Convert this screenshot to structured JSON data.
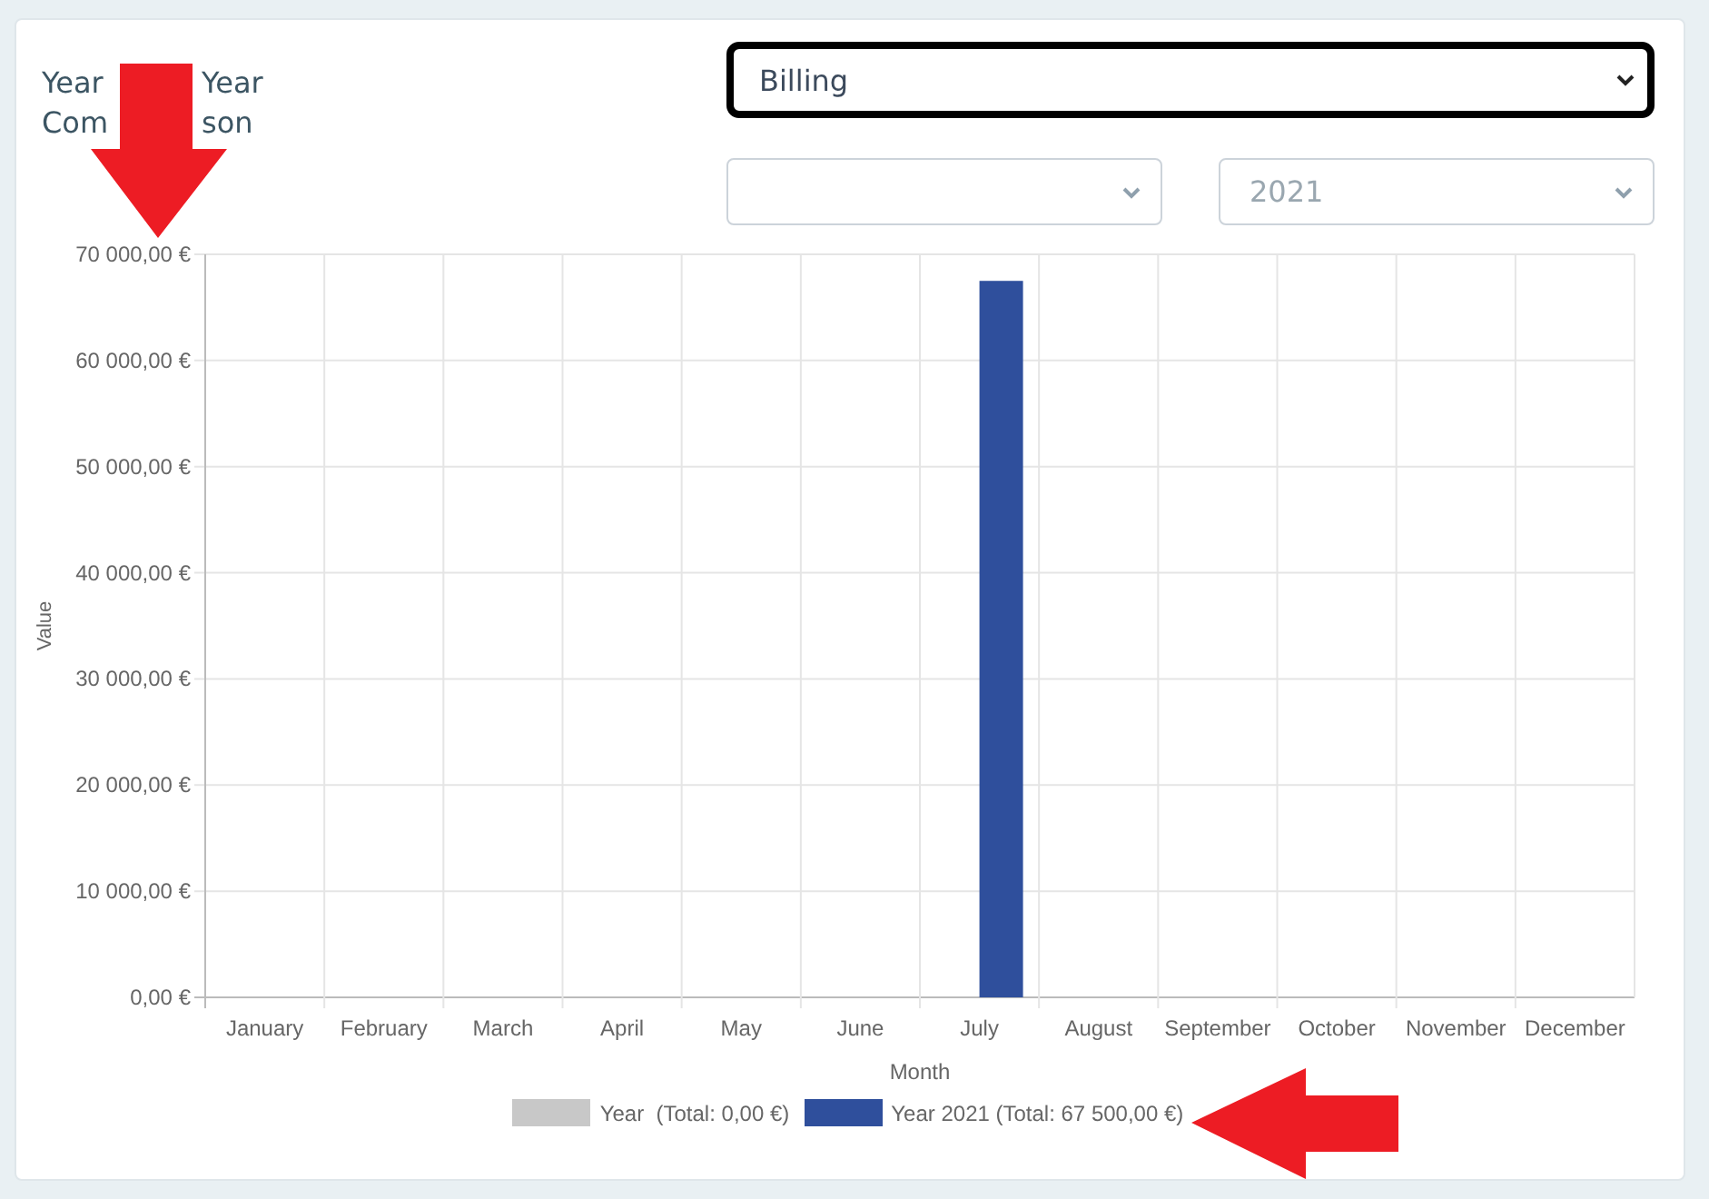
{
  "card": {
    "title_lines": [
      [
        "Year",
        "Year"
      ],
      [
        "Com",
        "son"
      ]
    ]
  },
  "filters": {
    "metric": {
      "value": "Billing",
      "focused": true
    },
    "year": {
      "value": "2021"
    }
  },
  "chart": {
    "chart_data": {
      "type": "bar",
      "grid": true,
      "xlabel": "Month",
      "ylabel": "Value",
      "categories": [
        "January",
        "February",
        "March",
        "April",
        "May",
        "June",
        "July",
        "August",
        "September",
        "October",
        "November",
        "December"
      ],
      "ylim": [
        0,
        70000
      ],
      "yticks": [
        {
          "value": 0,
          "label": "0,00 €"
        },
        {
          "value": 10000,
          "label": "10 000,00 €"
        },
        {
          "value": 20000,
          "label": "20 000,00 €"
        },
        {
          "value": 30000,
          "label": "30 000,00 €"
        },
        {
          "value": 40000,
          "label": "40 000,00 €"
        },
        {
          "value": 50000,
          "label": "50 000,00 €"
        },
        {
          "value": 60000,
          "label": "60 000,00 €"
        },
        {
          "value": 70000,
          "label": "70 000,00 €"
        }
      ],
      "series": [
        {
          "name": "Year  (Total: 0,00 €)",
          "color": "#c8c8c8",
          "values": [
            0,
            0,
            0,
            0,
            0,
            0,
            0,
            0,
            0,
            0,
            0,
            0
          ]
        },
        {
          "name": "Year 2021 (Total: 67 500,00 €)",
          "color": "#2f4f9c",
          "values": [
            0,
            0,
            0,
            0,
            0,
            0,
            67500,
            0,
            0,
            0,
            0,
            0
          ]
        }
      ]
    }
  }
}
